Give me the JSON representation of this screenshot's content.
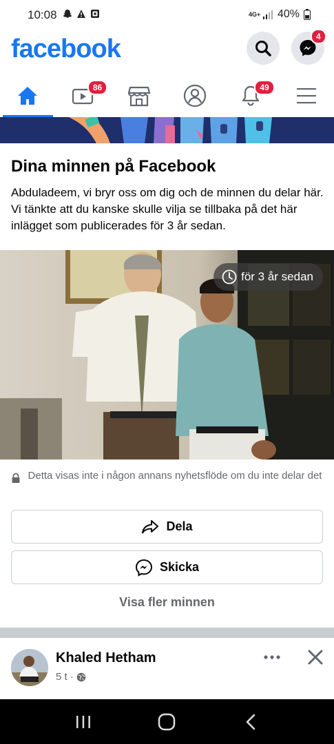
{
  "status_bar": {
    "time": "10:08",
    "network": "4G+",
    "battery": "40%"
  },
  "header": {
    "logo": "facebook",
    "brand_color": "#1877f2",
    "search_icon": "search-icon",
    "messenger_icon": "messenger-icon",
    "messenger_badge": "4"
  },
  "tabs": [
    {
      "name": "home",
      "icon": "home-icon",
      "active": true,
      "badge": ""
    },
    {
      "name": "watch",
      "icon": "video-icon",
      "active": false,
      "badge": "86"
    },
    {
      "name": "marketplace",
      "icon": "store-icon",
      "active": false,
      "badge": ""
    },
    {
      "name": "profile",
      "icon": "profile-icon",
      "active": false,
      "badge": ""
    },
    {
      "name": "notifications",
      "icon": "bell-icon",
      "active": false,
      "badge": "49"
    },
    {
      "name": "menu",
      "icon": "hamburger-icon",
      "active": false,
      "badge": ""
    }
  ],
  "memory": {
    "title": "Dina minnen på Facebook",
    "description": "Abduladeem, vi bryr oss om dig och de minnen du delar här. Vi tänkte att du kanske skulle vilja se tillbaka på det här inlägget som publicerades för 3 år sedan.",
    "time_ago": "för 3 år sedan",
    "privacy_note": "Detta visas inte i någon annans nyhetsflöde om du inte delar det",
    "share_label": "Dela",
    "send_label": "Skicka",
    "more_label": "Visa fler minnen"
  },
  "post": {
    "author": "Khaled Hetham",
    "time": "5 t",
    "separator": "·"
  },
  "navbar": {
    "recents_icon": "recents-icon",
    "home_icon": "home-circle-icon",
    "back_icon": "back-icon"
  }
}
